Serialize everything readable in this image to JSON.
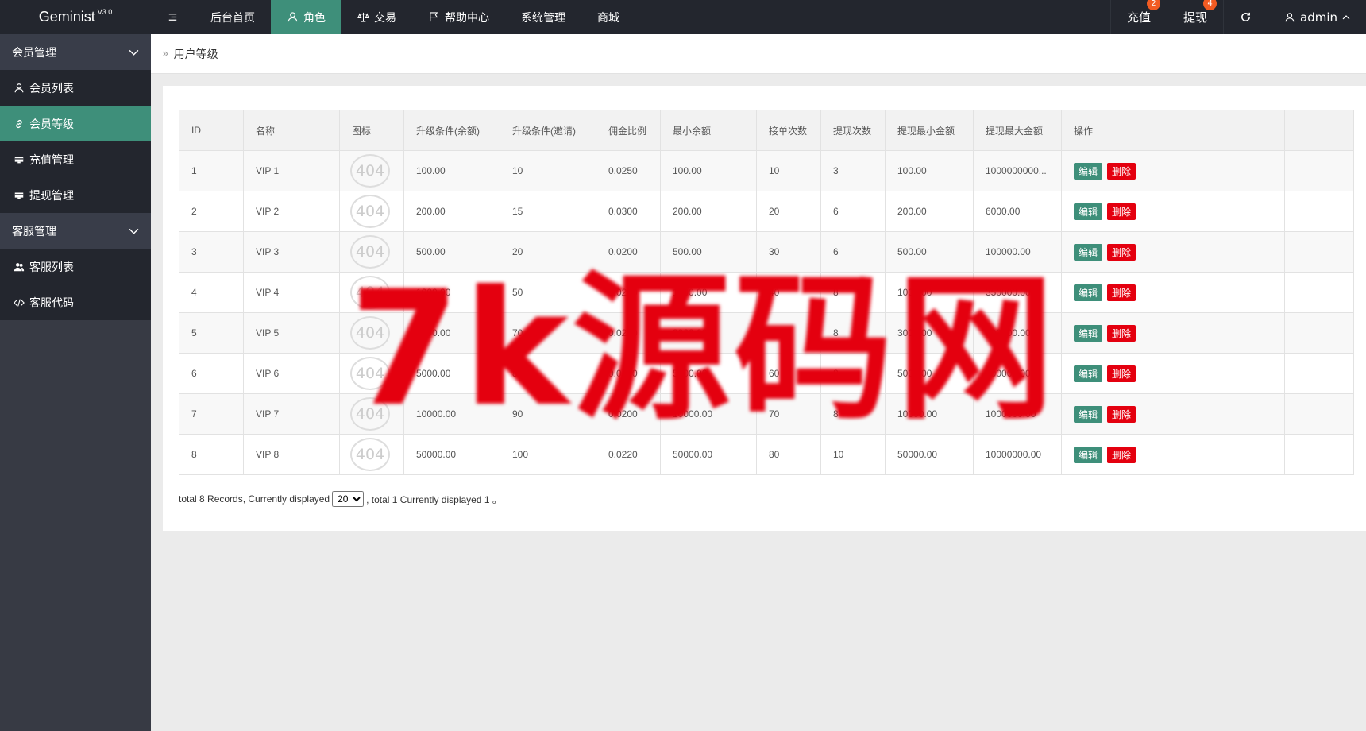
{
  "app": {
    "name": "Geminist",
    "version": "V3.0"
  },
  "topnav": [
    {
      "label": "",
      "icon": "menu-icon"
    },
    {
      "label": "后台首页",
      "icon": ""
    },
    {
      "label": "角色",
      "icon": "user-icon",
      "active": true
    },
    {
      "label": "交易",
      "icon": "scale-icon"
    },
    {
      "label": "帮助中心",
      "icon": "flag-icon"
    },
    {
      "label": "系统管理",
      "icon": ""
    },
    {
      "label": "商城",
      "icon": ""
    }
  ],
  "topright": {
    "recharge": {
      "label": "充值",
      "badge": "2"
    },
    "withdraw": {
      "label": "提现",
      "badge": "4"
    },
    "user": "admin"
  },
  "sidebar": {
    "groups": [
      {
        "label": "会员管理",
        "items": [
          {
            "label": "会员列表",
            "icon": "user-icon"
          },
          {
            "label": "会员等级",
            "icon": "link-icon",
            "active": true
          },
          {
            "label": "充值管理",
            "icon": "card-icon"
          },
          {
            "label": "提现管理",
            "icon": "card-icon"
          }
        ]
      },
      {
        "label": "客服管理",
        "items": [
          {
            "label": "客服列表",
            "icon": "users-icon"
          },
          {
            "label": "客服代码",
            "icon": "code-icon"
          }
        ]
      }
    ]
  },
  "breadcrumb": "用户等级",
  "table": {
    "headers": [
      "ID",
      "名称",
      "图标",
      "升级条件(余额)",
      "升级条件(邀请)",
      "佣金比例",
      "最小余额",
      "接单次数",
      "提现次数",
      "提现最小金额",
      "提现最大金额",
      "操作"
    ],
    "rows": [
      [
        "1",
        "VIP 1",
        "404",
        "100.00",
        "10",
        "0.0250",
        "100.00",
        "10",
        "3",
        "100.00",
        "1000000000..."
      ],
      [
        "2",
        "VIP 2",
        "404",
        "200.00",
        "15",
        "0.0300",
        "200.00",
        "20",
        "6",
        "200.00",
        "6000.00"
      ],
      [
        "3",
        "VIP 3",
        "404",
        "500.00",
        "20",
        "0.0200",
        "500.00",
        "30",
        "6",
        "500.00",
        "100000.00"
      ],
      [
        "4",
        "VIP 4",
        "404",
        "1000.00",
        "50",
        "0.0200",
        "1000.00",
        "40",
        "8",
        "1000.00",
        "350000.00"
      ],
      [
        "5",
        "VIP 5",
        "404",
        "3000.00",
        "70",
        "0.0200",
        "3000.00",
        "50",
        "8",
        "3000.00",
        "500000.00"
      ],
      [
        "6",
        "VIP 6",
        "404",
        "5000.00",
        "80",
        "0.0200",
        "5000.00",
        "60",
        "8",
        "5000.00",
        "800000.00"
      ],
      [
        "7",
        "VIP 7",
        "404",
        "10000.00",
        "90",
        "0.0200",
        "10000.00",
        "70",
        "8",
        "10000.00",
        "1000000.00"
      ],
      [
        "8",
        "VIP 8",
        "404",
        "50000.00",
        "100",
        "0.0220",
        "50000.00",
        "80",
        "10",
        "50000.00",
        "10000000.00"
      ]
    ],
    "edit_label": "编辑",
    "delete_label": "删除"
  },
  "pager": {
    "before": "total 8 Records,  Currently displayed",
    "select_value": "20",
    "after": ",  total 1 Currently displayed 1 。"
  },
  "watermark": "7k源码网",
  "colors": {
    "accent": "#3e8f7a",
    "danger": "#e4000f",
    "topbar": "#23262e",
    "sidebar": "#373a44",
    "badge": "#f25b22"
  }
}
